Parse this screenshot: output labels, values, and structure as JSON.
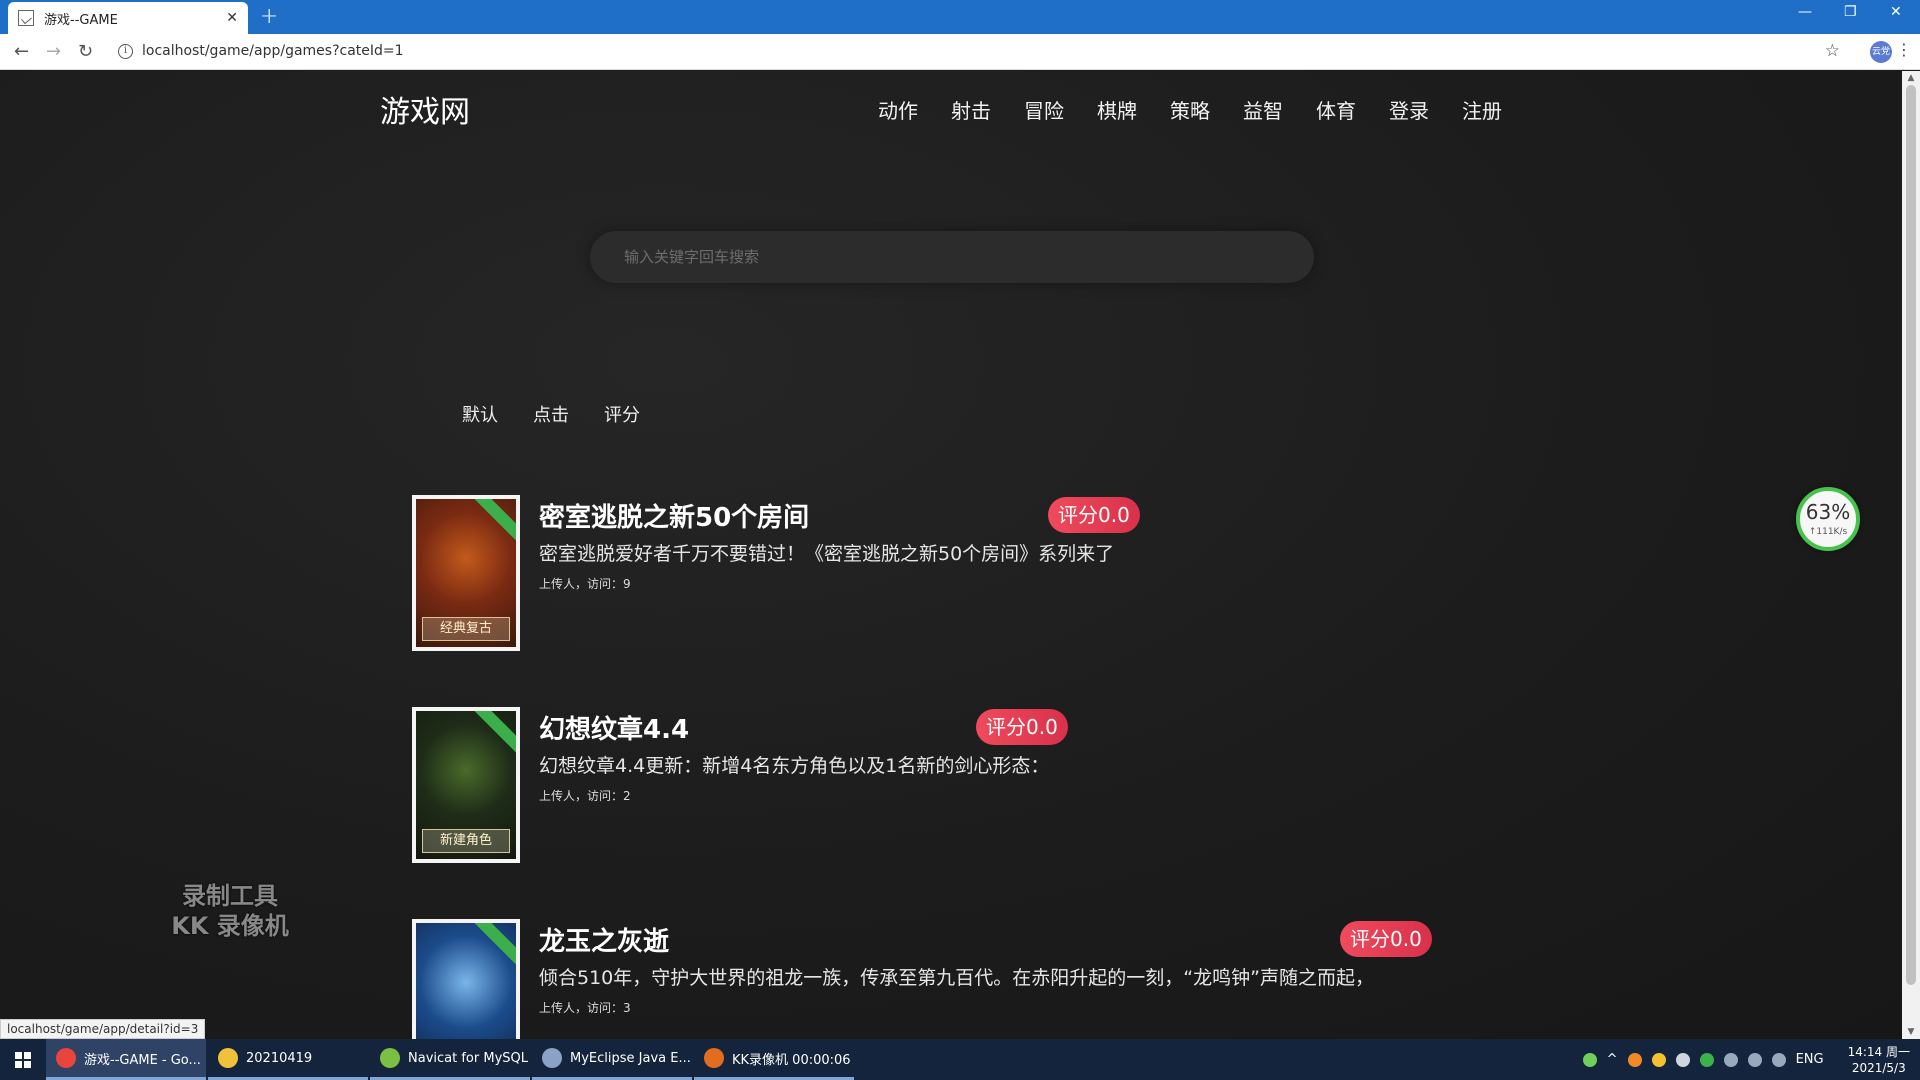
{
  "browser": {
    "tab_title": "游戏--GAME",
    "tab_close": "✕",
    "new_tab": "+",
    "url": "localhost/game/app/games?cateId=1",
    "profile_label": "云党",
    "window_controls": [
      "—",
      "❐",
      "✕"
    ],
    "status_url": "localhost/game/app/detail?id=3"
  },
  "site": {
    "logo": "游戏网",
    "nav": [
      "动作",
      "射击",
      "冒险",
      "棋牌",
      "策略",
      "益智",
      "体育",
      "登录",
      "注册"
    ],
    "search_placeholder": "输入关键字回车搜索",
    "sort": [
      "默认",
      "点击",
      "评分"
    ]
  },
  "games": [
    {
      "title": "密室逃脱之新50个房间",
      "desc": "密室逃脱爱好者千万不要错过！《密室逃脱之新50个房间》系列来了",
      "meta": "上传人，访问：9",
      "rating": "评分0.0",
      "thumb_caption": "经典复古",
      "thumb_colors": [
        "#7a2a12",
        "#c45a1c",
        "#3b1a0c"
      ]
    },
    {
      "title": "幻想纹章4.4",
      "desc": "幻想纹章4.4更新：新增4名东方角色以及1名新的剑心形态：",
      "meta": "上传人，访问：2",
      "rating": "评分0.0",
      "thumb_caption": "新建角色",
      "thumb_colors": [
        "#1e2c18",
        "#4a6a2a",
        "#14180f"
      ]
    },
    {
      "title": "龙玉之灰逝",
      "desc": "倾合510年，守护大世界的祖龙一族，传承至第九百代。在赤阳升起的一刻，“龙鸣钟”声随之而起，",
      "meta": "上传人，访问：3",
      "rating": "评分0.0",
      "thumb_caption": "",
      "thumb_colors": [
        "#1c4c8c",
        "#79b6e8",
        "#0d2246"
      ]
    }
  ],
  "overlay": {
    "speed_percent": "63%",
    "speed_rate": "↑111K/s",
    "watermark_line1": "录制工具",
    "watermark_line2": "KK 录像机"
  },
  "taskbar": {
    "items": [
      {
        "label": "游戏--GAME - Go...",
        "color": "#e8453c"
      },
      {
        "label": "20210419",
        "color": "#f0c23b"
      },
      {
        "label": "Navicat for MySQL",
        "color": "#7bc043"
      },
      {
        "label": "MyEclipse Java E...",
        "color": "#8aa2c8"
      },
      {
        "label": "KK录像机 00:00:06",
        "color": "#e26d1f"
      }
    ],
    "lang": "ENG",
    "time": "14:14 周一",
    "date": "2021/5/3"
  }
}
